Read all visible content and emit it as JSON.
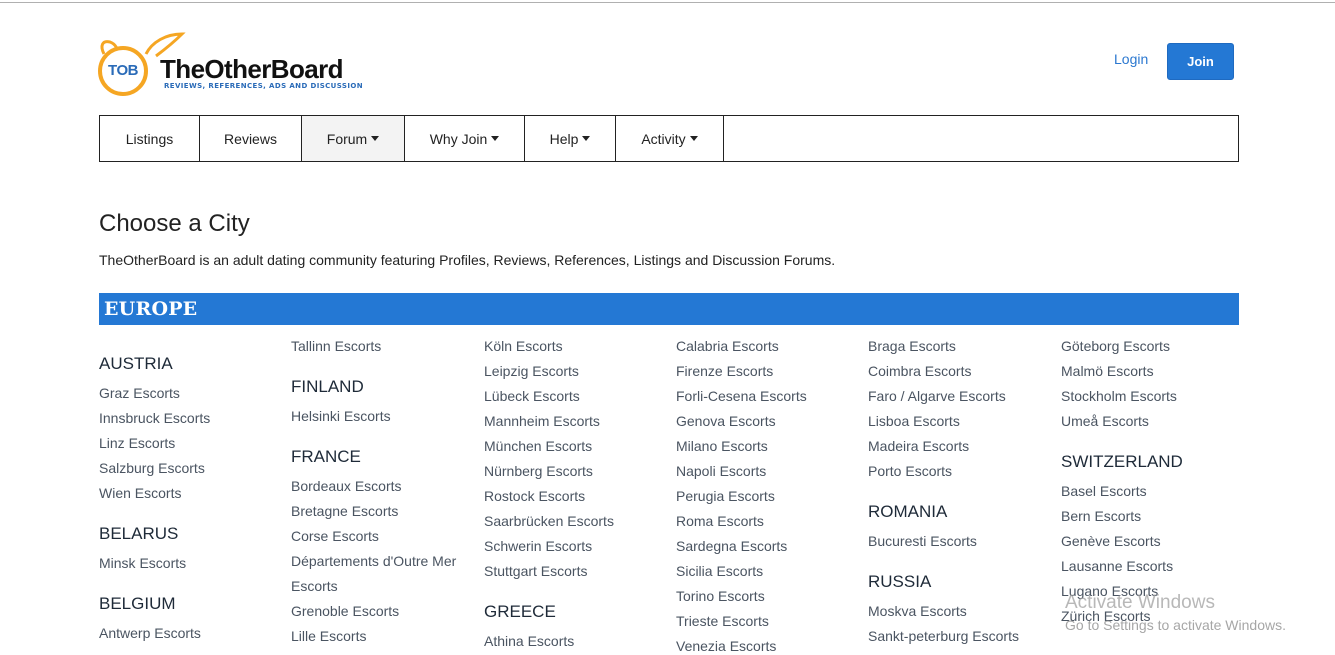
{
  "header": {
    "logo_badge": "TOB",
    "logo_name": "TheOtherBoard",
    "logo_tagline": "REVIEWS, REFERENCES, ADS AND DISCUSSION",
    "login_label": "Login",
    "join_label": "Join"
  },
  "nav": {
    "items": [
      {
        "label": "Listings",
        "dropdown": false
      },
      {
        "label": "Reviews",
        "dropdown": false
      },
      {
        "label": "Forum",
        "dropdown": true,
        "active": true
      },
      {
        "label": "Why Join",
        "dropdown": true
      },
      {
        "label": "Help",
        "dropdown": true
      },
      {
        "label": "Activity",
        "dropdown": true
      }
    ]
  },
  "page": {
    "title": "Choose a City",
    "intro": "TheOtherBoard is an adult dating community featuring Profiles, Reviews, References, Listings and Discussion Forums."
  },
  "region": {
    "name": "EUROPE",
    "columns": [
      [
        {
          "type": "country",
          "text": "AUSTRIA"
        },
        {
          "type": "city",
          "text": "Graz Escorts"
        },
        {
          "type": "city",
          "text": "Innsbruck Escorts"
        },
        {
          "type": "city",
          "text": "Linz Escorts"
        },
        {
          "type": "city",
          "text": "Salzburg Escorts"
        },
        {
          "type": "city",
          "text": "Wien Escorts"
        },
        {
          "type": "country",
          "text": "BELARUS"
        },
        {
          "type": "city",
          "text": "Minsk Escorts"
        },
        {
          "type": "country",
          "text": "BELGIUM"
        },
        {
          "type": "city",
          "text": "Antwerp Escorts"
        }
      ],
      [
        {
          "type": "city",
          "text": "Tallinn Escorts"
        },
        {
          "type": "country",
          "text": "FINLAND"
        },
        {
          "type": "city",
          "text": "Helsinki Escorts"
        },
        {
          "type": "country",
          "text": "FRANCE"
        },
        {
          "type": "city",
          "text": "Bordeaux Escorts"
        },
        {
          "type": "city",
          "text": "Bretagne Escorts"
        },
        {
          "type": "city",
          "text": "Corse Escorts"
        },
        {
          "type": "city",
          "text": "Départements d'Outre Mer"
        },
        {
          "type": "city-cont",
          "text": "Escorts"
        },
        {
          "type": "city",
          "text": "Grenoble Escorts"
        },
        {
          "type": "city",
          "text": "Lille Escorts"
        }
      ],
      [
        {
          "type": "city",
          "text": "Köln Escorts"
        },
        {
          "type": "city",
          "text": "Leipzig Escorts"
        },
        {
          "type": "city",
          "text": "Lübeck Escorts"
        },
        {
          "type": "city",
          "text": "Mannheim Escorts"
        },
        {
          "type": "city",
          "text": "München Escorts"
        },
        {
          "type": "city",
          "text": "Nürnberg Escorts"
        },
        {
          "type": "city",
          "text": "Rostock Escorts"
        },
        {
          "type": "city",
          "text": "Saarbrücken Escorts"
        },
        {
          "type": "city",
          "text": "Schwerin Escorts"
        },
        {
          "type": "city",
          "text": "Stuttgart Escorts"
        },
        {
          "type": "country",
          "text": "GREECE"
        },
        {
          "type": "city",
          "text": "Athina Escorts"
        }
      ],
      [
        {
          "type": "city",
          "text": "Calabria Escorts"
        },
        {
          "type": "city",
          "text": "Firenze Escorts"
        },
        {
          "type": "city",
          "text": "Forli-Cesena Escorts"
        },
        {
          "type": "city",
          "text": "Genova Escorts"
        },
        {
          "type": "city",
          "text": "Milano Escorts"
        },
        {
          "type": "city",
          "text": "Napoli Escorts"
        },
        {
          "type": "city",
          "text": "Perugia Escorts"
        },
        {
          "type": "city",
          "text": "Roma Escorts"
        },
        {
          "type": "city",
          "text": "Sardegna Escorts"
        },
        {
          "type": "city",
          "text": "Sicilia Escorts"
        },
        {
          "type": "city",
          "text": "Torino Escorts"
        },
        {
          "type": "city",
          "text": "Trieste Escorts"
        },
        {
          "type": "city",
          "text": "Venezia Escorts"
        }
      ],
      [
        {
          "type": "city",
          "text": "Braga Escorts"
        },
        {
          "type": "city",
          "text": "Coimbra Escorts"
        },
        {
          "type": "city",
          "text": "Faro / Algarve Escorts"
        },
        {
          "type": "city",
          "text": "Lisboa Escorts"
        },
        {
          "type": "city",
          "text": "Madeira Escorts"
        },
        {
          "type": "city",
          "text": "Porto Escorts"
        },
        {
          "type": "country",
          "text": "ROMANIA"
        },
        {
          "type": "city",
          "text": "Bucuresti Escorts"
        },
        {
          "type": "country",
          "text": "RUSSIA"
        },
        {
          "type": "city",
          "text": "Moskva Escorts"
        },
        {
          "type": "city",
          "text": "Sankt-peterburg Escorts"
        }
      ],
      [
        {
          "type": "city",
          "text": "Göteborg Escorts"
        },
        {
          "type": "city",
          "text": "Malmö Escorts"
        },
        {
          "type": "city",
          "text": "Stockholm Escorts"
        },
        {
          "type": "city",
          "text": "Umeå Escorts"
        },
        {
          "type": "country",
          "text": "SWITZERLAND"
        },
        {
          "type": "city",
          "text": "Basel Escorts"
        },
        {
          "type": "city",
          "text": "Bern Escorts"
        },
        {
          "type": "city",
          "text": "Genève Escorts"
        },
        {
          "type": "city",
          "text": "Lausanne Escorts"
        },
        {
          "type": "city",
          "text": "Lugano Escorts"
        },
        {
          "type": "city",
          "text": "Zürich Escorts"
        }
      ]
    ]
  },
  "watermark": {
    "line1": "Activate Windows",
    "line2": "Go to Settings to activate Windows."
  },
  "colors": {
    "accent": "#2478d4",
    "logo_orange": "#f5a623",
    "link": "#2b78d0"
  }
}
